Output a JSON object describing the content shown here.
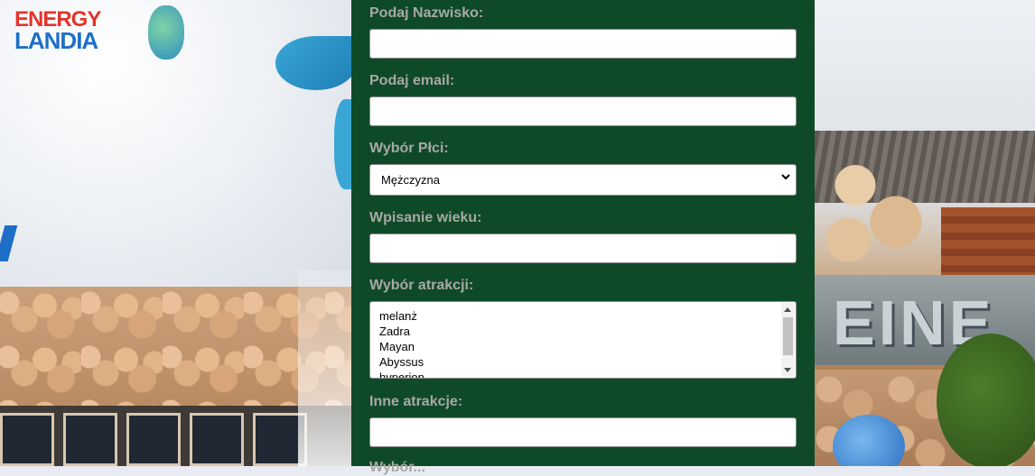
{
  "logo": {
    "line1": "ENERGY",
    "line2": "LANDIA"
  },
  "background_sign": "EINE",
  "form": {
    "surname": {
      "label": "Podaj Nazwisko:",
      "value": ""
    },
    "email": {
      "label": "Podaj email:",
      "value": ""
    },
    "gender": {
      "label": "Wybór Płci:",
      "selected": "Mężczyzna"
    },
    "age": {
      "label": "Wpisanie wieku:",
      "value": ""
    },
    "attractions": {
      "label": "Wybór atrakcji:",
      "options": [
        "melanż",
        "Zadra",
        "Mayan",
        "Abyssus",
        "hyperion"
      ]
    },
    "other_attractions": {
      "label": "Inne atrakcje:",
      "value": ""
    },
    "next_label_cut": "Wybór..."
  },
  "colors": {
    "panel": "#0f4a28",
    "label": "#a7a9a2"
  }
}
